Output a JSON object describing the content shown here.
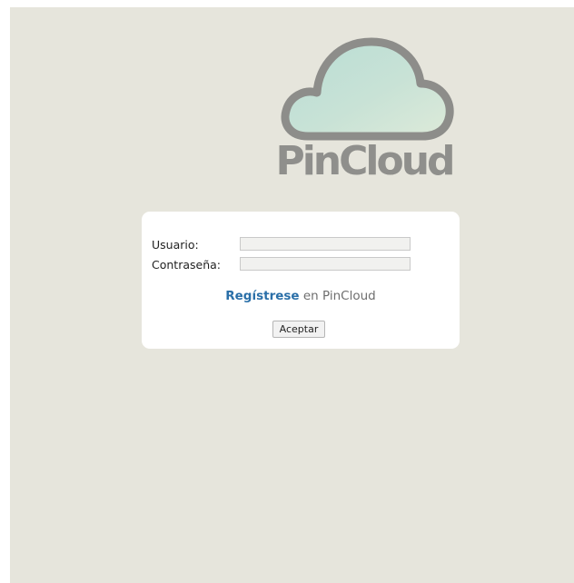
{
  "brand": {
    "name": "PinCloud",
    "logo_icon": "cloud-icon",
    "text_color": "#8f8f8c",
    "cloud_outline_color": "#8d8d8a"
  },
  "login": {
    "username_label": "Usuario:",
    "username_value": "",
    "password_label": "Contraseña:",
    "password_value": "",
    "register_link_text": "Regístrese",
    "register_suffix": "en PinCloud",
    "register_link_color": "#2a6fa8",
    "submit_label": "Aceptar"
  },
  "colors": {
    "page_background": "#e6e5dc",
    "panel_background": "#ffffff"
  }
}
